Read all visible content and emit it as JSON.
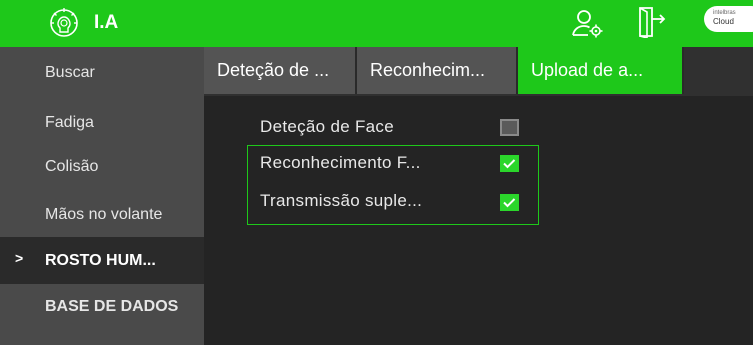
{
  "header": {
    "title": "I.A",
    "badge_line1": "intelbras",
    "badge_line2": "Cloud",
    "icons": [
      "brain-ia-icon",
      "user-settings-icon",
      "exit-door-icon"
    ],
    "accent_color": "#1ec81a"
  },
  "sidebar": {
    "items": [
      {
        "label": "Buscar",
        "active": false
      },
      {
        "label": "Fadiga",
        "active": false
      },
      {
        "label": "Colisão",
        "active": false
      },
      {
        "label": "Mãos no volante",
        "active": false
      },
      {
        "label": "ROSTO HUM...",
        "active": true
      },
      {
        "label": "BASE DE DADOS",
        "active": false
      }
    ],
    "active_marker": ">"
  },
  "tabs": [
    {
      "label": "Deteção de ...",
      "active": false
    },
    {
      "label": "Reconhecim...",
      "active": false
    },
    {
      "label": "Upload de a...",
      "active": true
    }
  ],
  "options": [
    {
      "label": "Deteção de Face",
      "checked": false
    },
    {
      "label": "Reconhecimento F...",
      "checked": true
    },
    {
      "label": "Transmissão suple...",
      "checked": true
    }
  ]
}
